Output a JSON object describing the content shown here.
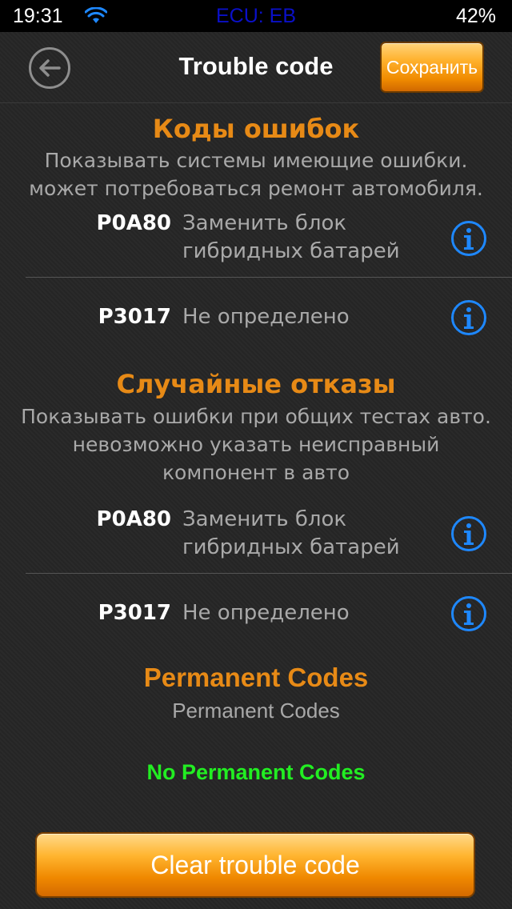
{
  "status_bar": {
    "time": "19:31",
    "ecu": "ECU: EB",
    "battery": "42%",
    "wifi_icon": "wifi-icon"
  },
  "nav": {
    "title": "Trouble code",
    "save_label": "Сохранить",
    "back_icon": "back-arrow-icon"
  },
  "sections": [
    {
      "title": "Коды ошибок",
      "desc_lines": [
        "Показывать системы имеющие ошибки.",
        "может потребоваться ремонт автомобиля."
      ],
      "codes": [
        {
          "code": "P0A80",
          "desc_lines": [
            "Заменить блок",
            "гибридных батарей"
          ]
        },
        {
          "code": "P3017",
          "desc_lines": [
            "Не определено"
          ]
        }
      ]
    },
    {
      "title": "Случайные отказы",
      "desc_lines": [
        "Показывать ошибки при общих тестах авто.",
        "невозможно указать неисправный",
        "компонент в авто"
      ],
      "codes": [
        {
          "code": "P0A80",
          "desc_lines": [
            "Заменить блок",
            "гибридных батарей"
          ]
        },
        {
          "code": "P3017",
          "desc_lines": [
            "Не определено"
          ]
        }
      ]
    }
  ],
  "permanent": {
    "title": "Permanent Codes",
    "subtitle": "Permanent Codes",
    "empty_message": "No Permanent Codes"
  },
  "clear_button_label": "Clear trouble code",
  "colors": {
    "accent_orange": "#e78a16",
    "ecu_blue": "#0a10c8",
    "info_blue": "#1e88ff",
    "success_green": "#22ee22"
  }
}
